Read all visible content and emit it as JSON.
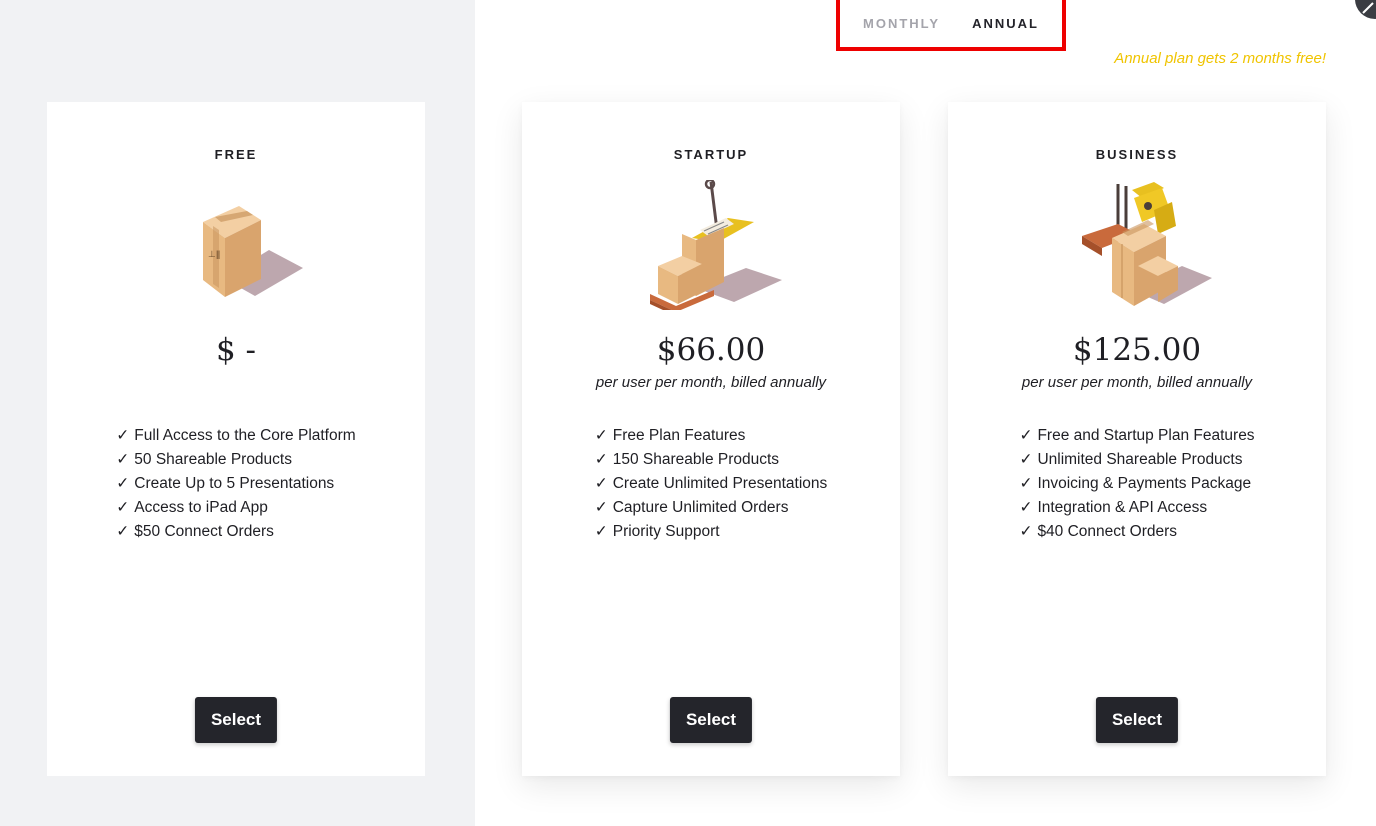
{
  "billing_toggle": {
    "monthly_label": "MONTHLY",
    "annual_label": "ANNUAL",
    "selected": "ANNUAL"
  },
  "promo_text": "Annual plan gets 2 months free!",
  "colors": {
    "promo": "#f0c400",
    "highlight_border": "#ee0000",
    "button_bg": "#24252b",
    "left_panel_bg": "#f1f2f4"
  },
  "plans": [
    {
      "name": "FREE",
      "icon": "single-box-icon",
      "price": "$ -",
      "billing_note": "",
      "features": [
        "Full Access to the Core Platform",
        "50 Shareable Products",
        "Create Up to 5 Presentations",
        "Access to iPad App",
        "$50 Connect Orders"
      ],
      "button_label": "Select"
    },
    {
      "name": "STARTUP",
      "icon": "pallet-jack-icon",
      "price": "$66.00",
      "billing_note": "per user per month, billed annually",
      "features": [
        "Free Plan Features",
        "150 Shareable Products",
        "Create Unlimited Presentations",
        "Capture Unlimited Orders",
        "Priority Support"
      ],
      "button_label": "Select"
    },
    {
      "name": "BUSINESS",
      "icon": "forklift-icon",
      "price": "$125.00",
      "billing_note": "per user per month, billed annually",
      "features": [
        "Free and Startup Plan Features",
        "Unlimited Shareable Products",
        "Invoicing & Payments Package",
        "Integration & API Access",
        "$40 Connect Orders"
      ],
      "button_label": "Select"
    }
  ],
  "check_glyph": "✓"
}
